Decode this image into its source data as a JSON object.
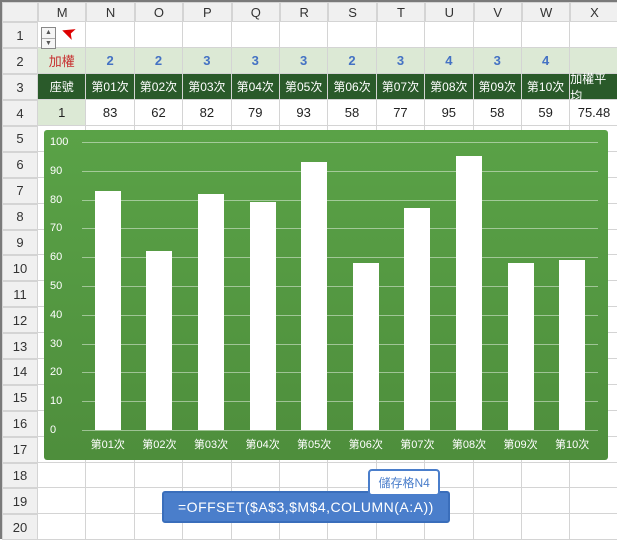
{
  "columns": [
    "M",
    "N",
    "O",
    "P",
    "Q",
    "R",
    "S",
    "T",
    "U",
    "V",
    "W",
    "X"
  ],
  "row_nums": [
    1,
    2,
    3,
    4,
    5,
    6,
    7,
    8,
    9,
    10,
    11,
    12,
    13,
    14,
    15,
    16,
    17,
    18,
    19,
    20
  ],
  "row2": {
    "label": "加權",
    "weights": [
      "2",
      "2",
      "3",
      "3",
      "3",
      "2",
      "3",
      "4",
      "3",
      "4"
    ],
    "last": ""
  },
  "row3": {
    "label": "座號",
    "headers": [
      "第01次",
      "第02次",
      "第03次",
      "第04次",
      "第05次",
      "第06次",
      "第07次",
      "第08次",
      "第09次",
      "第10次",
      "加權平均"
    ]
  },
  "row4": {
    "seat": "1",
    "values": [
      "83",
      "62",
      "82",
      "79",
      "93",
      "58",
      "77",
      "95",
      "58",
      "59",
      "75.48"
    ]
  },
  "chart_data": {
    "type": "bar",
    "categories": [
      "第01次",
      "第02次",
      "第03次",
      "第04次",
      "第05次",
      "第06次",
      "第07次",
      "第08次",
      "第09次",
      "第10次"
    ],
    "values": [
      83,
      62,
      82,
      79,
      93,
      58,
      77,
      95,
      58,
      59
    ],
    "yticks": [
      0,
      10,
      20,
      30,
      40,
      50,
      60,
      70,
      80,
      90,
      100
    ],
    "ylim": [
      0,
      100
    ],
    "title": "",
    "xlabel": "",
    "ylabel": ""
  },
  "formula": {
    "tag": "儲存格N4",
    "text": "=OFFSET($A$3,$M$4,COLUMN(A:A))"
  }
}
